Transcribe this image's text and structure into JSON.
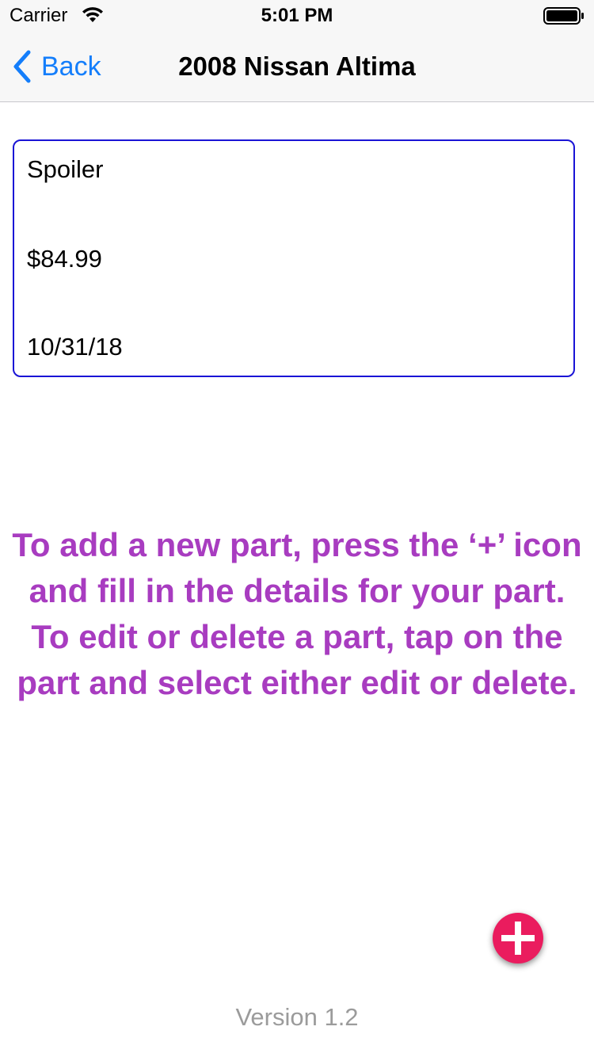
{
  "status_bar": {
    "carrier": "Carrier",
    "time": "5:01 PM",
    "wifi_icon": "wifi-icon",
    "battery_icon": "battery-icon"
  },
  "nav": {
    "back_label": "Back",
    "back_icon": "chevron-left-icon",
    "title": "2008 Nissan Altima"
  },
  "part": {
    "name": "Spoiler",
    "price": "$84.99",
    "date": "10/31/18"
  },
  "instructions": "To add a new part, press the ‘+’ icon and fill in the details for your part. To edit or delete a part, tap on the part and select either edit or delete.",
  "add_button": {
    "icon": "plus-icon"
  },
  "footer": {
    "version": "Version 1.2"
  },
  "colors": {
    "accent_blue": "#147efb",
    "card_border": "#1a14d6",
    "instruction_text": "#a83cc0",
    "add_button": "#ea1c5e",
    "version_text": "#9b9b9b"
  }
}
